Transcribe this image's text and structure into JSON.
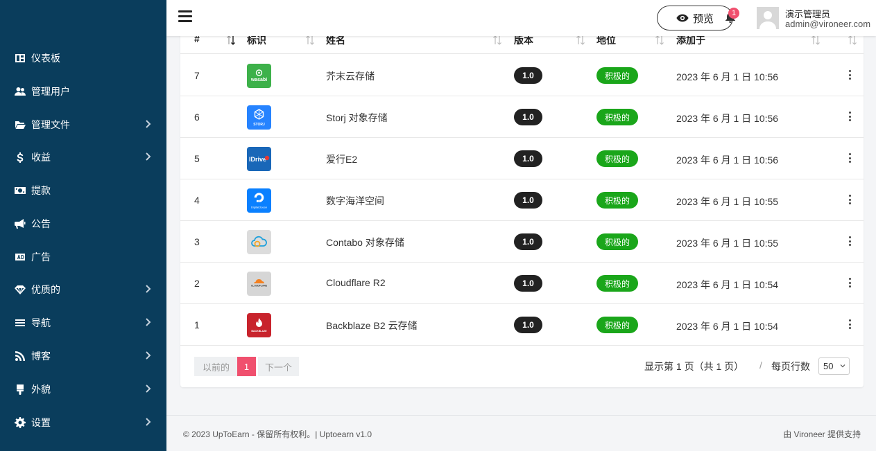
{
  "sidebar": {
    "items": [
      {
        "label": "仪表板",
        "icon": "dashboard-icon",
        "chevron": false
      },
      {
        "label": "管理用户",
        "icon": "users-icon",
        "chevron": false
      },
      {
        "label": "管理文件",
        "icon": "folder-icon",
        "chevron": true
      },
      {
        "label": "收益",
        "icon": "dollar-icon",
        "chevron": true
      },
      {
        "label": "提款",
        "icon": "money-icon",
        "chevron": false
      },
      {
        "label": "公告",
        "icon": "megaphone-icon",
        "chevron": false
      },
      {
        "label": "广告",
        "icon": "ad-icon",
        "chevron": false
      },
      {
        "label": "优质的",
        "icon": "diamond-icon",
        "chevron": true
      },
      {
        "label": "导航",
        "icon": "bars-icon",
        "chevron": true
      },
      {
        "label": "博客",
        "icon": "rss-icon",
        "chevron": true
      },
      {
        "label": "外貌",
        "icon": "brush-icon",
        "chevron": true
      },
      {
        "label": "设置",
        "icon": "gear-icon",
        "chevron": true
      }
    ]
  },
  "header": {
    "preview_label": "预览",
    "notification_count": "1",
    "user_name": "演示管理员",
    "user_email": "admin@vironeer.com"
  },
  "table": {
    "columns": [
      "#",
      "标识",
      "姓名",
      "版本",
      "地位",
      "添加于"
    ],
    "rows": [
      {
        "id": "7",
        "logo": "wasabi",
        "logo_text": "wasabi",
        "logo_color": "#3db14a",
        "name": "芥末云存储",
        "version": "1.0",
        "status": "积极的",
        "added": "2023 年 6 月 1 日 10:56"
      },
      {
        "id": "6",
        "logo": "storj",
        "logo_text": "STORJ",
        "logo_color": "#2683ff",
        "name": "Storj 对象存储",
        "version": "1.0",
        "status": "积极的",
        "added": "2023 年 6 月 1 日 10:56"
      },
      {
        "id": "5",
        "logo": "idrive",
        "logo_text": "IDrive",
        "logo_color": "#1967b8",
        "name": "爱行E2",
        "version": "1.0",
        "status": "积极的",
        "added": "2023 年 6 月 1 日 10:56"
      },
      {
        "id": "4",
        "logo": "digitalocean",
        "logo_text": "DigitalOcean",
        "logo_color": "#0a80ff",
        "name": "数字海洋空间",
        "version": "1.0",
        "status": "积极的",
        "added": "2023 年 6 月 1 日 10:55"
      },
      {
        "id": "3",
        "logo": "contabo",
        "logo_text": "",
        "logo_color": "#dcdcdc",
        "name": "Contabo 对象存储",
        "version": "1.0",
        "status": "积极的",
        "added": "2023 年 6 月 1 日 10:55"
      },
      {
        "id": "2",
        "logo": "cloudflare",
        "logo_text": "CLOUDFLARE",
        "logo_color": "#d6d6d6",
        "name": "Cloudflare R2",
        "version": "1.0",
        "status": "积极的",
        "added": "2023 年 6 月 1 日 10:54"
      },
      {
        "id": "1",
        "logo": "backblaze",
        "logo_text": "BACKBLAZE",
        "logo_color": "#c8232c",
        "name": "Backblaze B2 云存储",
        "version": "1.0",
        "status": "积极的",
        "added": "2023 年 6 月 1 日 10:54"
      }
    ]
  },
  "pagination": {
    "prev_label": "以前的",
    "current": "1",
    "next_label": "下一个",
    "info": "显示第 1 页（共 1 页）",
    "separator": "/",
    "per_page_label": "每页行数",
    "per_page_value": "50"
  },
  "footer": {
    "left": "© 2023 UpToEarn - 保留所有权利。| Uptoearn v1.0",
    "right": "由 Vironeer 提供支持"
  }
}
